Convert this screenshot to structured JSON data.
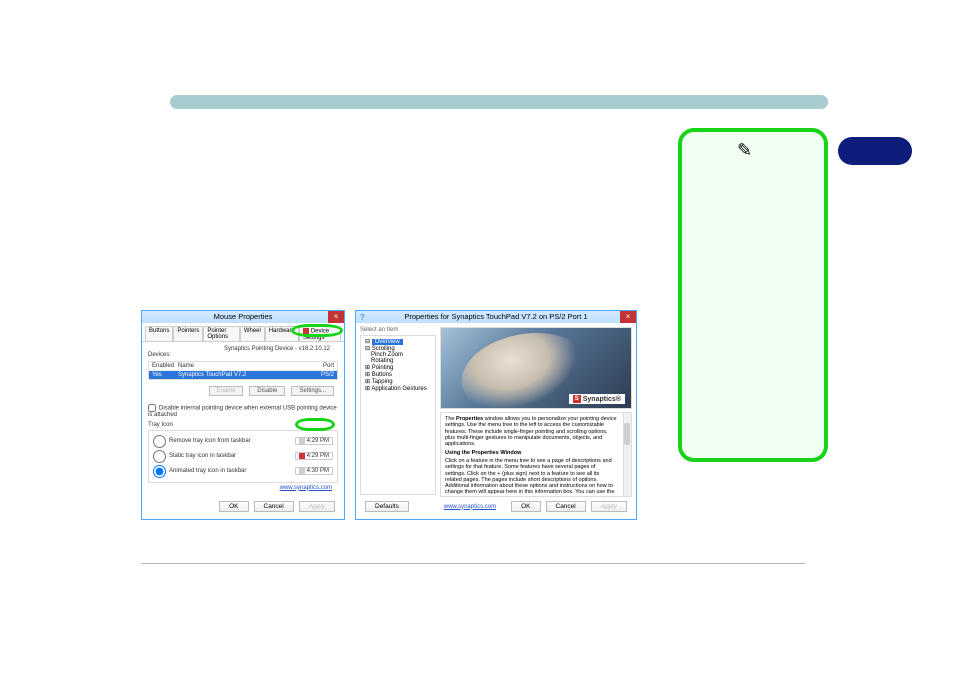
{
  "leftDialog": {
    "title": "Mouse Properties",
    "tabs": [
      "Buttons",
      "Pointers",
      "Pointer Options",
      "Wheel",
      "Hardware",
      "Device Settings"
    ],
    "versionLine": "Synaptics Pointing Device - v16.2.10.12",
    "devicesLabel": "Devices:",
    "cols": {
      "enabled": "Enabled",
      "name": "Name",
      "port": "Port"
    },
    "deviceSel": {
      "enabled": "Yes",
      "name": "Synaptics TouchPad V7.2",
      "port": "PS/2"
    },
    "btnEnable": "Enable",
    "btnDisable": "Disable",
    "btnSettings": "Settings...",
    "disableExternal": "Disable internal pointing device when external USB pointing device is attached",
    "trayHeader": "Tray Icon",
    "trayOptions": {
      "remove": "Remove tray icon from taskbar",
      "static": "Static tray icon in taskbar",
      "animated": "Animated tray icon in taskbar"
    },
    "times": {
      "remove": "4:29 PM",
      "static": "4:29 PM",
      "animated": "4:30 PM"
    },
    "link": "www.synaptics.com",
    "btnOK": "OK",
    "btnCancel": "Cancel",
    "btnApply": "Apply"
  },
  "rightDialog": {
    "title": "Properties for Synaptics TouchPad V7.2 on PS/2 Port 1",
    "selectLabel": "Select an Item",
    "tree": {
      "overview": "Overview",
      "scrolling": "Scrolling",
      "pinch": "Pinch Zoom",
      "rotating": "Rotating",
      "pointing": "Pointing",
      "buttons": "Buttons",
      "tapping": "Tapping",
      "appgest": "Application Gestures"
    },
    "logo": "Synaptics",
    "descIntro": "The Properties window allows you to personalize your pointing device settings. Use the menu tree to the left to access the customizable features. These include single-finger pointing and scrolling options, plus multi-finger gestures to manipulate documents, objects, and applications.",
    "descHeader": "Using the Properties Window",
    "descBody": "Click on a feature in the menu tree to see a page of descriptions and settings for that feature. Some features have several pages of settings. Click on the + (plus sign) next to a feature to see all its related pages. The pages include short descriptions of options. Additional information about these options and instructions on how to change them will appear here in this information box. You can use the scroll bar to view the",
    "btnDefaults": "Defaults",
    "link": "www.synaptics.com",
    "btnOK": "OK",
    "btnCancel": "Cancel",
    "btnApply": "Apply"
  }
}
